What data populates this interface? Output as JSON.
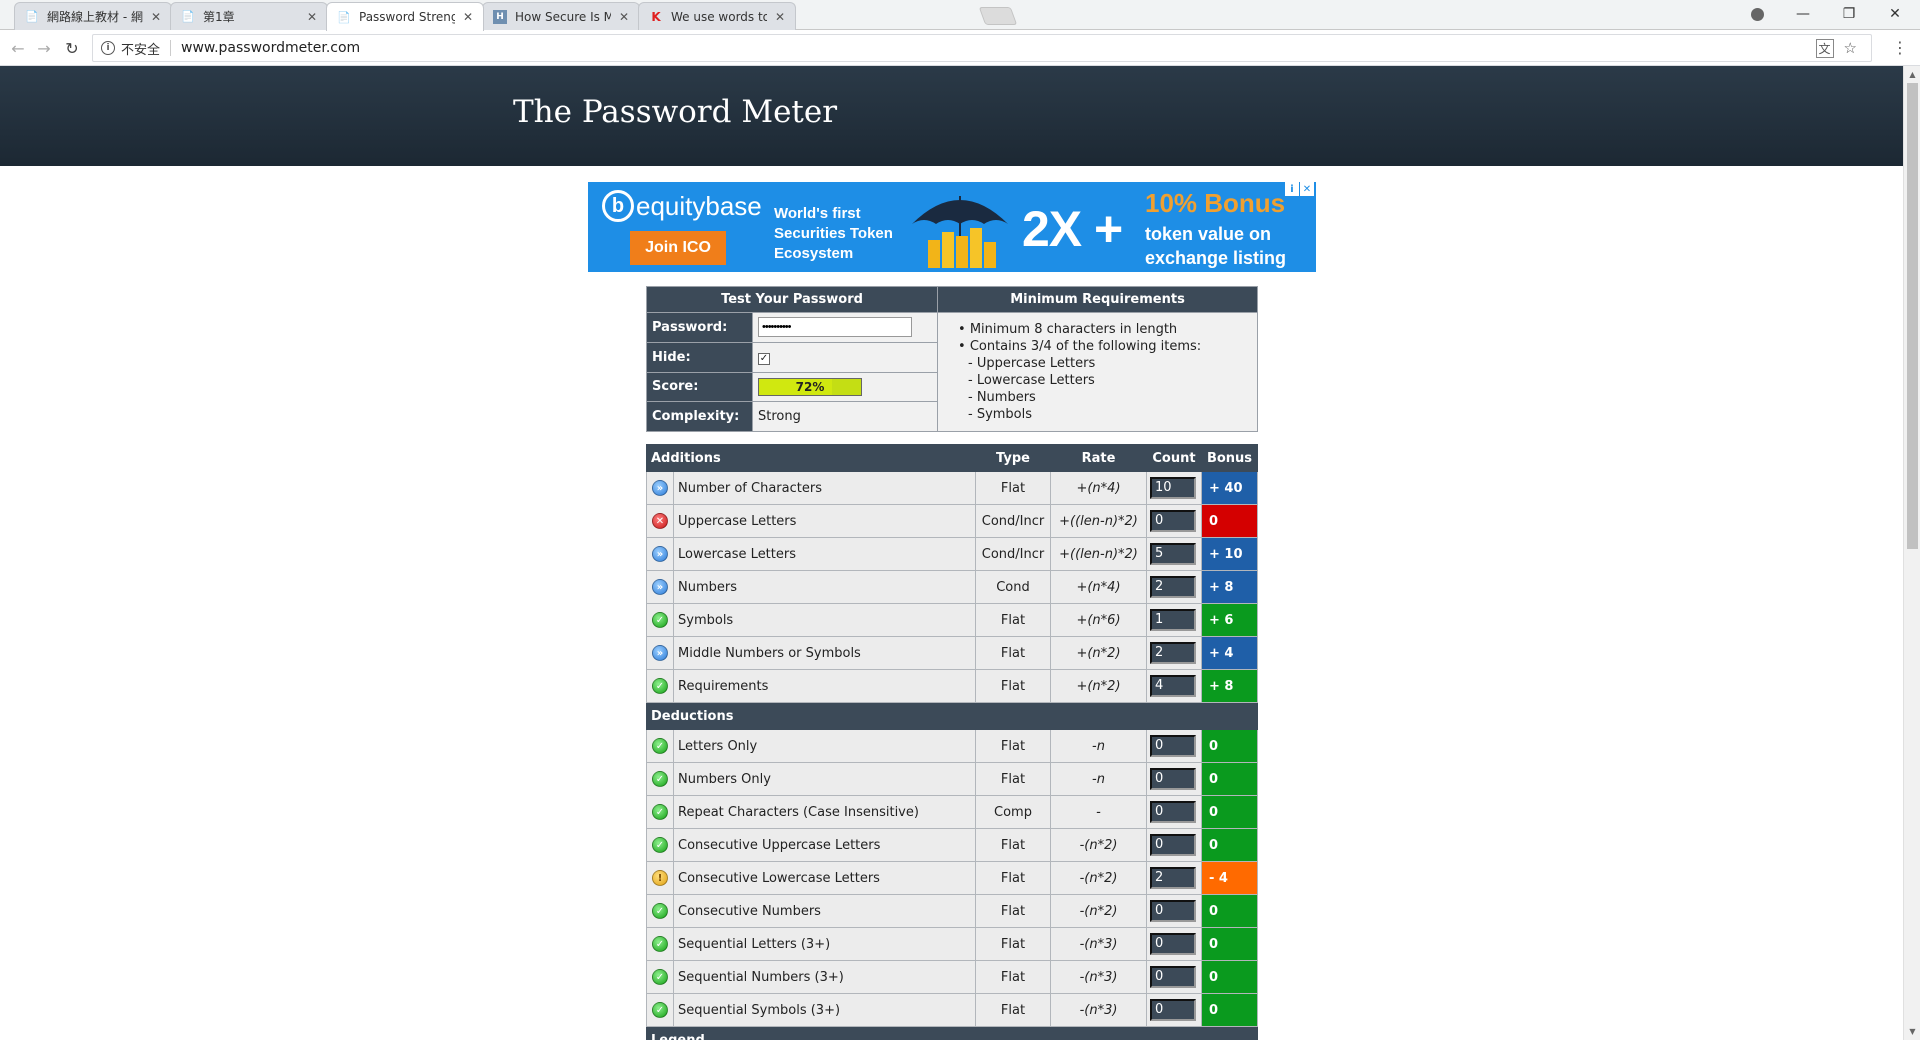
{
  "browser": {
    "tabs": [
      {
        "title": "網路線上教材 - 網路安全",
        "icon": "document-icon",
        "active": false
      },
      {
        "title": "第1章",
        "icon": "document-icon",
        "active": false
      },
      {
        "title": "Password Strength Che",
        "icon": "document-icon",
        "active": true
      },
      {
        "title": "How Secure Is My Pass",
        "icon": "howsecure-favicon",
        "active": false
      },
      {
        "title": "We use words to save t",
        "icon": "k-favicon",
        "active": false
      }
    ],
    "security_label": "不安全",
    "url": "www.passwordmeter.com"
  },
  "site": {
    "title": "The Password Meter"
  },
  "ad": {
    "logo_text": "equitybase",
    "logo_letter": "b",
    "cta": "Join ICO",
    "tagline": "World's first Securities Token Ecosystem",
    "multiplier": "2X +",
    "bonus": "10% Bonus",
    "bonus_detail": "token value on exchange listing",
    "adchoice_i": "i",
    "adchoice_x": "✕"
  },
  "test": {
    "header_left": "Test Your Password",
    "header_right": "Minimum Requirements",
    "password_label": "Password:",
    "password_value": "••••••••••",
    "hide_label": "Hide:",
    "hide_checked": true,
    "score_label": "Score:",
    "score_value": "72%",
    "score_fraction": 0.72,
    "complexity_label": "Complexity:",
    "complexity_value": "Strong",
    "requirements": {
      "r1": "Minimum 8 characters in length",
      "r2": "Contains 3/4 of the following items:",
      "s1": "- Uppercase Letters",
      "s2": "- Lowercase Letters",
      "s3": "- Numbers",
      "s4": "- Symbols"
    }
  },
  "scoring": {
    "columns": {
      "additions": "Additions",
      "type": "Type",
      "rate": "Rate",
      "count": "Count",
      "bonus": "Bonus"
    },
    "deductions_label": "Deductions",
    "legend_label": "Legend",
    "additions": [
      {
        "status": "exceed",
        "name": "Number of Characters",
        "type": "Flat",
        "rate": "+(n*4)",
        "count": "10",
        "bonus": "+ 40"
      },
      {
        "status": "fail",
        "name": "Uppercase Letters",
        "type": "Cond/Incr",
        "rate": "+((len-n)*2)",
        "count": "0",
        "bonus": "0"
      },
      {
        "status": "exceed",
        "name": "Lowercase Letters",
        "type": "Cond/Incr",
        "rate": "+((len-n)*2)",
        "count": "5",
        "bonus": "+ 10"
      },
      {
        "status": "exceed",
        "name": "Numbers",
        "type": "Cond",
        "rate": "+(n*4)",
        "count": "2",
        "bonus": "+ 8"
      },
      {
        "status": "pass",
        "name": "Symbols",
        "type": "Flat",
        "rate": "+(n*6)",
        "count": "1",
        "bonus": "+ 6"
      },
      {
        "status": "exceed",
        "name": "Middle Numbers or Symbols",
        "type": "Flat",
        "rate": "+(n*2)",
        "count": "2",
        "bonus": "+ 4"
      },
      {
        "status": "pass",
        "name": "Requirements",
        "type": "Flat",
        "rate": "+(n*2)",
        "count": "4",
        "bonus": "+ 8"
      }
    ],
    "deductions": [
      {
        "status": "pass",
        "name": "Letters Only",
        "type": "Flat",
        "rate": "-n",
        "count": "0",
        "bonus": "0"
      },
      {
        "status": "pass",
        "name": "Numbers Only",
        "type": "Flat",
        "rate": "-n",
        "count": "0",
        "bonus": "0"
      },
      {
        "status": "pass",
        "name": "Repeat Characters (Case Insensitive)",
        "type": "Comp",
        "rate": "-",
        "count": "0",
        "bonus": "0"
      },
      {
        "status": "pass",
        "name": "Consecutive Uppercase Letters",
        "type": "Flat",
        "rate": "-(n*2)",
        "count": "0",
        "bonus": "0"
      },
      {
        "status": "warn",
        "name": "Consecutive Lowercase Letters",
        "type": "Flat",
        "rate": "-(n*2)",
        "count": "2",
        "bonus": "- 4"
      },
      {
        "status": "pass",
        "name": "Consecutive Numbers",
        "type": "Flat",
        "rate": "-(n*2)",
        "count": "0",
        "bonus": "0"
      },
      {
        "status": "pass",
        "name": "Sequential Letters (3+)",
        "type": "Flat",
        "rate": "-(n*3)",
        "count": "0",
        "bonus": "0"
      },
      {
        "status": "pass",
        "name": "Sequential Numbers (3+)",
        "type": "Flat",
        "rate": "-(n*3)",
        "count": "0",
        "bonus": "0"
      },
      {
        "status": "pass",
        "name": "Sequential Symbols (3+)",
        "type": "Flat",
        "rate": "-(n*3)",
        "count": "0",
        "bonus": "0"
      }
    ],
    "colors": {
      "exceed": "#1f5fa8",
      "fail": "#d40000",
      "pass": "#0a9a1e",
      "warn": "#ff6a00",
      "header": "#3c4a58"
    }
  }
}
